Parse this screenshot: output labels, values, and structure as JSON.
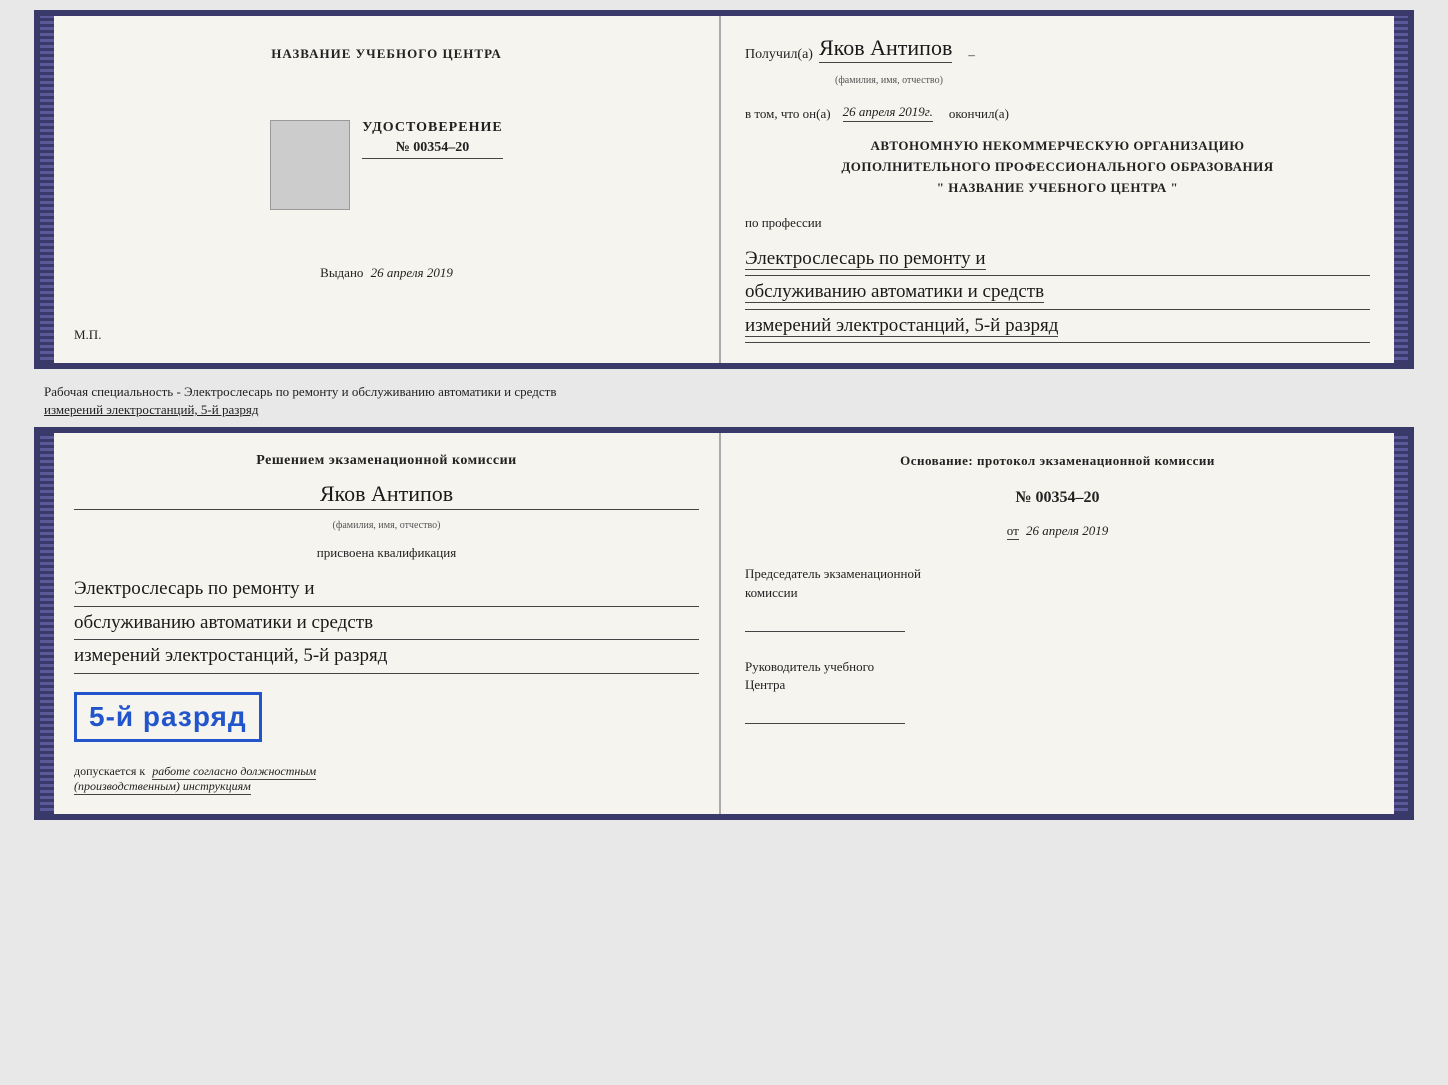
{
  "top_booklet": {
    "left": {
      "school_name": "НАЗВАНИЕ УЧЕБНОГО ЦЕНТРА",
      "cert_title": "УДОСТОВЕРЕНИЕ",
      "cert_number": "№ 00354–20",
      "vydano_label": "Выдано",
      "vydano_date": "26 апреля 2019",
      "mp": "М.П."
    },
    "right": {
      "poluchil_label": "Получил(а)",
      "recipient_name": "Яков Антипов",
      "fio_hint": "(фамилия, имя, отчество)",
      "vtom_label": "в том, что он(а)",
      "vtom_date": "26 апреля 2019г.",
      "okonchil_label": "окончил(а)",
      "org_line1": "АВТОНОМНУЮ НЕКОММЕРЧЕСКУЮ ОРГАНИЗАЦИЮ",
      "org_line2": "ДОПОЛНИТЕЛЬНОГО ПРОФЕССИОНАЛЬНОГО ОБРАЗОВАНИЯ",
      "org_quote": "\"   НАЗВАНИЕ УЧЕБНОГО ЦЕНТРА   \"",
      "po_professii_label": "по профессии",
      "profession_line1": "Электрослесарь по ремонту и",
      "profession_line2": "обслуживанию автоматики и средств",
      "profession_line3": "измерений электростанций, 5-й разряд"
    }
  },
  "separator": {
    "text_line1": "Рабочая специальность - Электрослесарь по ремонту и обслуживанию автоматики и средств",
    "text_line2": "измерений электростанций, 5-й разряд"
  },
  "bottom_booklet": {
    "left": {
      "komissia_title": "Решением экзаменационной комиссии",
      "komissia_name": "Яков Антипов",
      "fio_hint": "(фамилия, имя, отчество)",
      "prisvoena_label": "присвоена квалификация",
      "kvalif_line1": "Электрослесарь по ремонту и",
      "kvalif_line2": "обслуживанию автоматики и средств",
      "kvalif_line3": "измерений электростанций, 5-й разряд",
      "razryad_badge": "5-й разряд",
      "dopuskaetsya_label": "допускается к",
      "dopusk_text": "работе согласно должностным",
      "dopusk_text2": "(производственным) инструкциям"
    },
    "right": {
      "osnov_label": "Основание: протокол экзаменационной комиссии",
      "number_label": "№ 00354–20",
      "ot_label": "от",
      "ot_date": "26 апреля 2019",
      "chairman_line1": "Председатель экзаменационной",
      "chairman_line2": "комиссии",
      "rukov_line1": "Руководитель учебного",
      "rukov_line2": "Центра"
    }
  }
}
